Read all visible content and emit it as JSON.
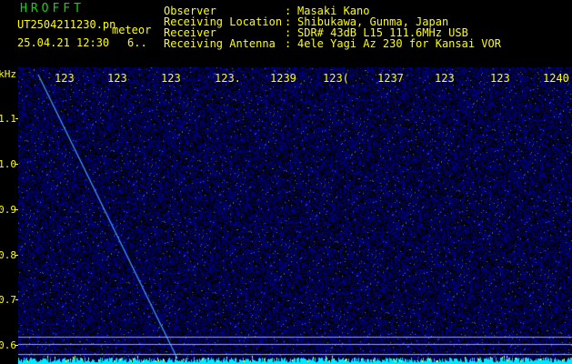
{
  "logo": "HROFFT",
  "file_name": "UT2504211230.pn",
  "file_type": "meteor",
  "date_time": "25.04.21 12:30",
  "count": "6..",
  "info": [
    {
      "label": "Observer",
      "value": "Masaki Kano"
    },
    {
      "label": "Receiving Location",
      "value": "Shibukawa, Gunma, Japan"
    },
    {
      "label": "Receiver",
      "value": "SDR# 43dB L15 111.6MHz USB"
    },
    {
      "label": "Receiving Antenna",
      "value": "4ele Yagi Az 230 for Kansai VOR"
    }
  ],
  "colon": ":",
  "y_axis": {
    "unit": "kHz",
    "ticks": [
      "1.1",
      "1.0",
      "0.9",
      "0.8",
      "0.7",
      "0.6"
    ]
  },
  "x_axis": {
    "ticks": [
      "123",
      "123",
      "123",
      "123.",
      "1239",
      "123(",
      "1237",
      "123",
      "123",
      "1240"
    ]
  },
  "colors": {
    "background": "#000000",
    "text": "#ffff00",
    "logo": "#00e000",
    "noise": "#1a1aa0",
    "trail": "#4aa0ff",
    "baseline": "#00e8ff"
  }
}
